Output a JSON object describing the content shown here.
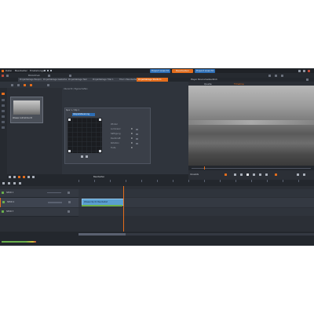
{
  "menu": {
    "items": [
      "Datei",
      "Bearbeiten",
      "Einstellungen"
    ]
  },
  "header_buttons": {
    "left": "Export Ansicht",
    "center": "Bearbeiten",
    "right": "Export Ansicht"
  },
  "top_tabs": {
    "library": "Bibliothek",
    "tabs": [
      "Projektablage Bauprojekt",
      "Projektablage Gestaltung",
      "Projektablage Test",
      "Projektablage Titel 1",
      "Titel 1 Bearbeiten",
      "Projektablage Stadium"
    ]
  },
  "player": {
    "title": "Player Panoramaüberblick",
    "tab_source": "Quelle",
    "tab_timeline": "Timeline",
    "speed": "Vorwärts"
  },
  "effect_panel": {
    "header": "Spur 1 / Clip 1",
    "dropdown": "Abspielsteuerung",
    "breadcrumb": "Übersicht / Eigenschaften",
    "controls": [
      "Winkel",
      "Luminanz",
      "Sättigung",
      "Deckkraft",
      "Rotation",
      "Tiefe"
    ],
    "numbers": [
      "0",
      "0",
      "0",
      "0",
      "0"
    ],
    "status": "Bearbeiten"
  },
  "library_item": {
    "label": "Wasser Aufnahme 01"
  },
  "tracks": [
    {
      "name": "SPUR 1",
      "clip": "Wasserclip 01 Bearbeitet"
    },
    {
      "name": "SPUR 2",
      "clip": ""
    },
    {
      "name": "SPUR 3",
      "clip": ""
    }
  ],
  "colors": {
    "accent": "#e46d1c",
    "header_btn": "#2d6fb7",
    "clip": "#5a9fd0",
    "clip_audio": "#6ab04c"
  }
}
